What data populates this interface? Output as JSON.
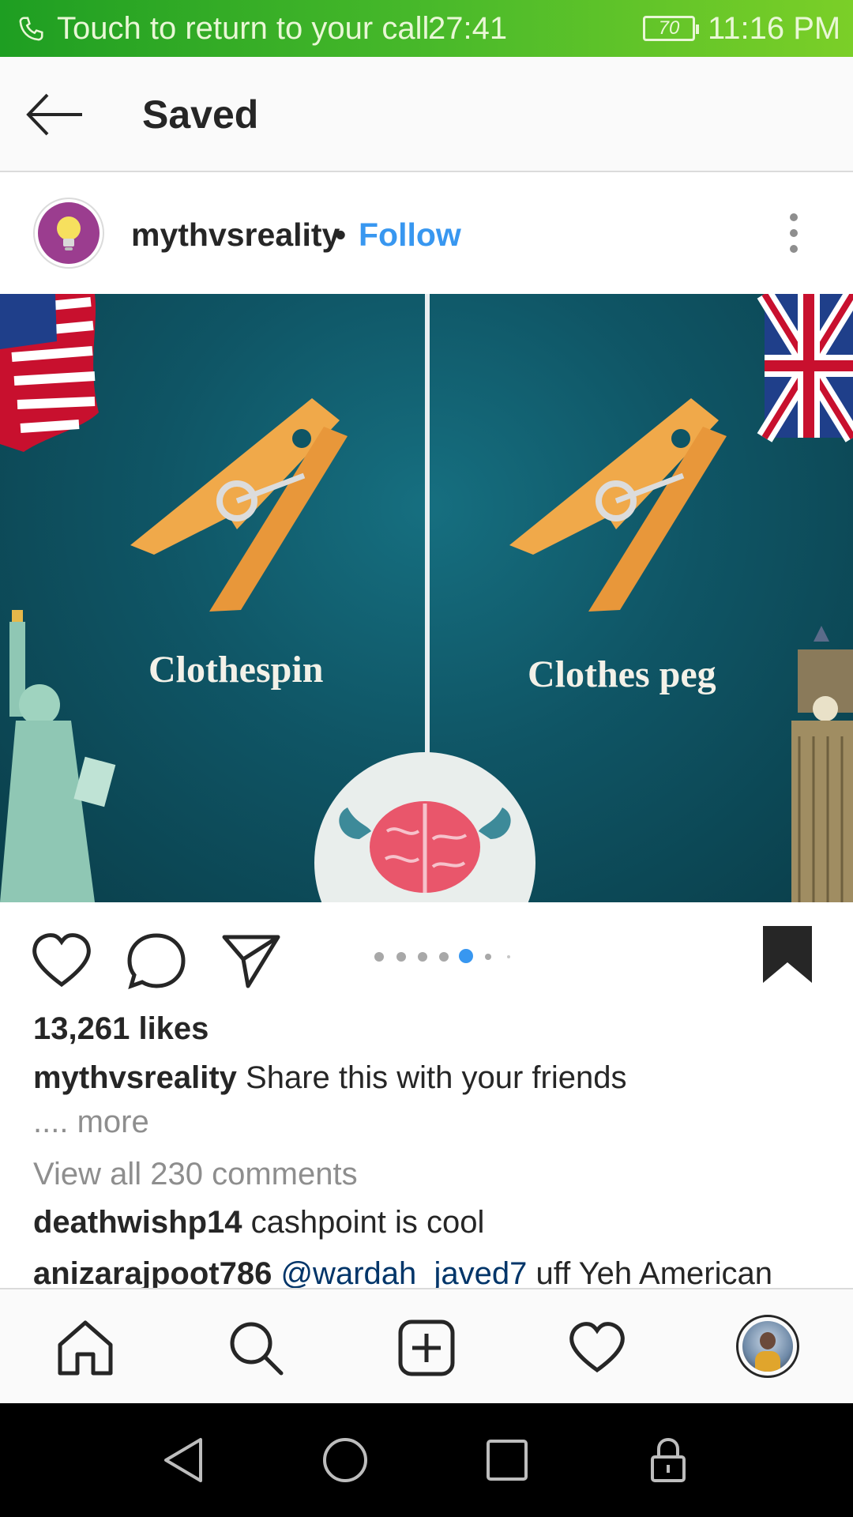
{
  "status_bar": {
    "call_text": "Touch to return to your call",
    "call_timer": "27:41",
    "battery": "70",
    "clock": "11:16 PM",
    "bar_color": "#48b92a"
  },
  "header": {
    "title": "Saved",
    "back_icon": "arrow-left-icon"
  },
  "post": {
    "username": "mythvsreality",
    "separator": "•",
    "follow_label": "Follow",
    "avatar_icon": "lightbulb-icon",
    "image": {
      "left_label": "Clothespin",
      "right_label": "Clothes peg"
    },
    "carousel": {
      "total": 7,
      "active_index": 4
    },
    "likes": "13,261 likes",
    "caption_user": "mythvsreality",
    "caption_text": "Share this with your friends",
    "caption_more_prefix": "....",
    "caption_more": "more",
    "view_comments": "View all 230 comments",
    "comments": [
      {
        "user": "deathwishp14",
        "mention": "",
        "text": "cashpoint is cool"
      },
      {
        "user": "anizarajpoot786",
        "mention": "@wardah_javed7",
        "text": "uff Yeh American"
      }
    ]
  },
  "bottom_nav": [
    "home-icon",
    "search-icon",
    "add-post-icon",
    "activity-heart-icon",
    "profile-avatar"
  ],
  "system_nav": [
    "back-triangle-icon",
    "home-circle-icon",
    "recents-square-icon",
    "lock-icon"
  ],
  "colors": {
    "link_blue": "#3897f0",
    "mention_blue": "#003569",
    "muted": "#8e8e8e"
  }
}
